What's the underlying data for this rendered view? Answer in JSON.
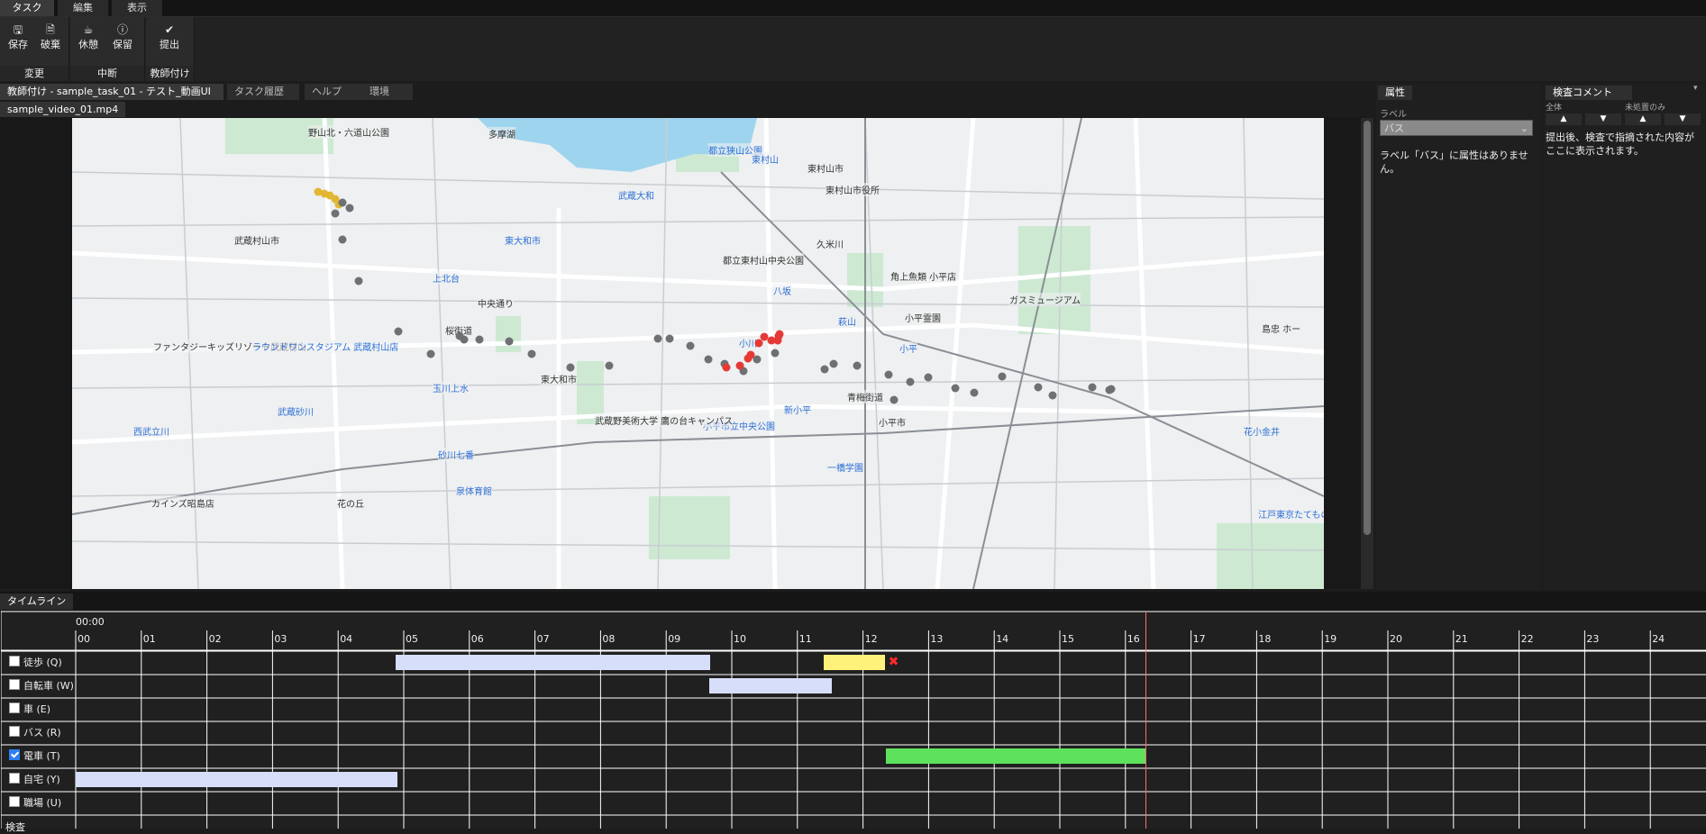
{
  "menu": {
    "tabs": [
      "タスク",
      "編集",
      "表示"
    ]
  },
  "ribbon": {
    "groups": [
      {
        "label": "変更",
        "buttons": [
          {
            "label": "保存",
            "icon": "save-icon"
          },
          {
            "label": "破棄",
            "icon": "discard-icon"
          }
        ]
      },
      {
        "label": "中断",
        "buttons": [
          {
            "label": "休憩",
            "icon": "coffee-icon"
          },
          {
            "label": "保留",
            "icon": "help-circle-icon"
          }
        ]
      },
      {
        "label": "教師付け",
        "buttons": [
          {
            "label": "提出",
            "icon": "check-icon"
          }
        ]
      }
    ]
  },
  "editor": {
    "tabs": [
      "教師付け - sample_task_01 - テスト_動画UI *",
      "タスク履歴",
      "ヘルプ",
      "環境"
    ],
    "file_tab": "sample_video_01.mp4"
  },
  "map": {
    "labels": [
      "野山北・六道山公園",
      "多摩湖",
      "都立狭山公園",
      "東村山",
      "東村山市",
      "東村山市役所",
      "武蔵大和",
      "武蔵村山市",
      "東大和市",
      "久米川",
      "都立東村山中央公園",
      "角上魚類 小平店",
      "ガスミュージアム",
      "上北台",
      "中央通り",
      "八坂",
      "萩山",
      "小平霊園",
      "桜街道",
      "ファンタジーキッズリゾート武蔵村山",
      "ラウンドワンスタジアム 武蔵村山店",
      "小川",
      "小平",
      "東大和市",
      "小平市立中央公園",
      "新小平",
      "青梅街道",
      "小平市",
      "玉川上水",
      "武蔵野美術大学 鷹の台キャンパス",
      "武蔵砂川",
      "西武立川",
      "花小金井",
      "砂川七番",
      "一橋学園",
      "泉体育館",
      "カインズ昭島店",
      "花の丘",
      "江戸東京たてもの園",
      "島忠 ホー"
    ],
    "track_colors": {
      "gray": "#6e7074",
      "red": "#e53935",
      "yellow": "#e2b634"
    }
  },
  "attr_panel": {
    "tab": "属性",
    "label_caption": "ラベル",
    "select_value": "バス",
    "message": "ラベル「バス」に属性はありません。"
  },
  "comment_panel": {
    "tab": "検査コメント",
    "scope_all": "全体",
    "scope_unresolved": "未処置のみ",
    "message": "提出後、検査で指摘された内容がここに表示されます。"
  },
  "timeline": {
    "tab": "タイムライン",
    "start_label": "00:00",
    "ticks": [
      "00",
      "01",
      "02",
      "03",
      "04",
      "05",
      "06",
      "07",
      "08",
      "09",
      "10",
      "11",
      "12",
      "13",
      "14",
      "15",
      "16",
      "17",
      "18",
      "19",
      "20",
      "21",
      "22",
      "23",
      "24"
    ],
    "rows": [
      {
        "label": "徒歩 (Q)",
        "checked": false
      },
      {
        "label": "自転車 (W)",
        "checked": false
      },
      {
        "label": "車 (E)",
        "checked": false
      },
      {
        "label": "バス (R)",
        "checked": false
      },
      {
        "label": "電車 (T)",
        "checked": true
      },
      {
        "label": "自宅 (Y)",
        "checked": false
      },
      {
        "label": "職場 (U)",
        "checked": false
      }
    ],
    "footer_label": "検査",
    "segments": [
      {
        "row": 0,
        "start": 4.88,
        "end": 9.67,
        "color": "#d6defa"
      },
      {
        "row": 0,
        "start": 11.4,
        "end": 12.33,
        "color": "#fff27a"
      },
      {
        "row": 1,
        "start": 9.65,
        "end": 11.53,
        "color": "#d6defa"
      },
      {
        "row": 4,
        "start": 12.35,
        "end": 16.3,
        "color": "#5ee25e"
      },
      {
        "row": 5,
        "start": 0.0,
        "end": 4.9,
        "color": "#d6defa"
      }
    ],
    "cursor_hour": 16.3,
    "delete_marker_after_segment": 1
  }
}
